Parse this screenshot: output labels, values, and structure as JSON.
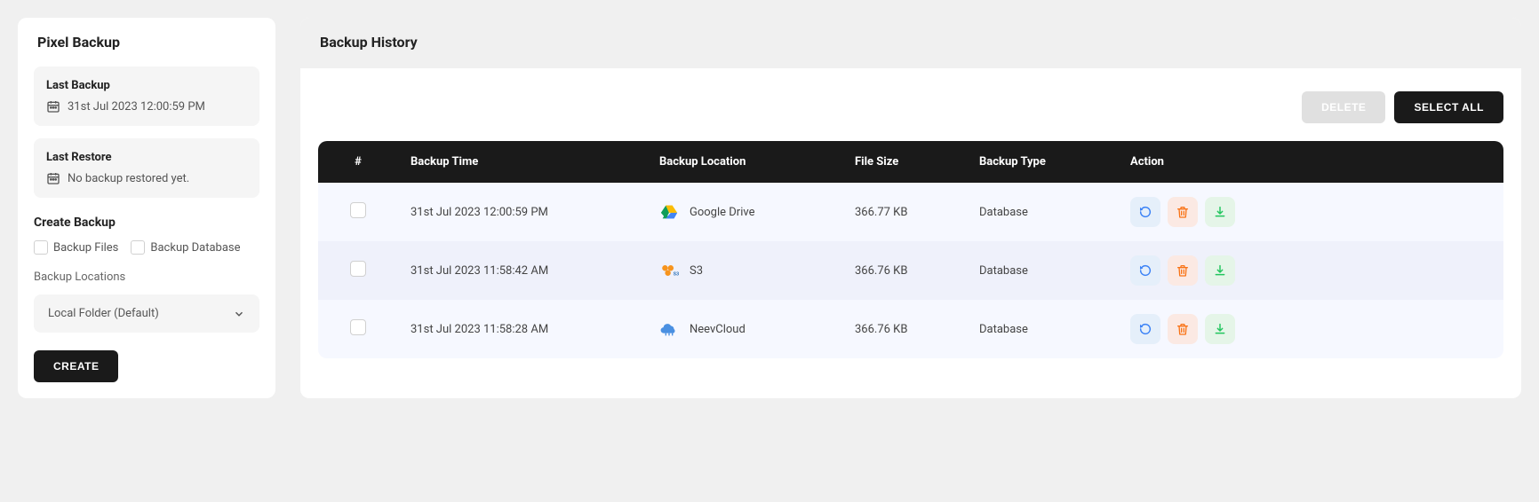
{
  "sidebar": {
    "title": "Pixel Backup",
    "last_backup": {
      "label": "Last Backup",
      "value": "31st Jul 2023 12:00:59 PM"
    },
    "last_restore": {
      "label": "Last Restore",
      "value": "No backup restored yet."
    },
    "create": {
      "title": "Create Backup",
      "backup_files_label": "Backup Files",
      "backup_database_label": "Backup Database",
      "locations_label": "Backup Locations",
      "location_selected": "Local Folder (Default)",
      "button": "CREATE"
    }
  },
  "main": {
    "title": "Backup History",
    "toolbar": {
      "delete": "DELETE",
      "select_all": "SELECT ALL"
    },
    "table": {
      "headers": {
        "num": "#",
        "time": "Backup Time",
        "location": "Backup Location",
        "size": "File Size",
        "type": "Backup Type",
        "action": "Action"
      },
      "rows": [
        {
          "time": "31st Jul 2023 12:00:59 PM",
          "location": "Google Drive",
          "icon": "gdrive",
          "size": "366.77 KB",
          "type": "Database"
        },
        {
          "time": "31st Jul 2023 11:58:42 AM",
          "location": "S3",
          "icon": "s3",
          "size": "366.76 KB",
          "type": "Database"
        },
        {
          "time": "31st Jul 2023 11:58:28 AM",
          "location": "NeevCloud",
          "icon": "neevcloud",
          "size": "366.76 KB",
          "type": "Database"
        }
      ]
    }
  }
}
